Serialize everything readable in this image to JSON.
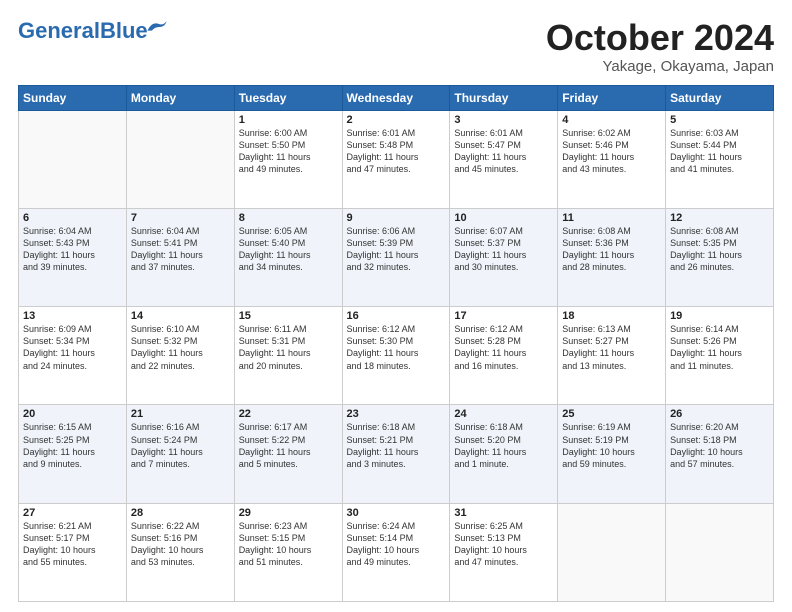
{
  "header": {
    "logo_general": "General",
    "logo_blue": "Blue",
    "title": "October 2024",
    "location": "Yakage, Okayama, Japan"
  },
  "days": [
    "Sunday",
    "Monday",
    "Tuesday",
    "Wednesday",
    "Thursday",
    "Friday",
    "Saturday"
  ],
  "weeks": [
    [
      {
        "day": "",
        "info": ""
      },
      {
        "day": "",
        "info": ""
      },
      {
        "day": "1",
        "info": "Sunrise: 6:00 AM\nSunset: 5:50 PM\nDaylight: 11 hours\nand 49 minutes."
      },
      {
        "day": "2",
        "info": "Sunrise: 6:01 AM\nSunset: 5:48 PM\nDaylight: 11 hours\nand 47 minutes."
      },
      {
        "day": "3",
        "info": "Sunrise: 6:01 AM\nSunset: 5:47 PM\nDaylight: 11 hours\nand 45 minutes."
      },
      {
        "day": "4",
        "info": "Sunrise: 6:02 AM\nSunset: 5:46 PM\nDaylight: 11 hours\nand 43 minutes."
      },
      {
        "day": "5",
        "info": "Sunrise: 6:03 AM\nSunset: 5:44 PM\nDaylight: 11 hours\nand 41 minutes."
      }
    ],
    [
      {
        "day": "6",
        "info": "Sunrise: 6:04 AM\nSunset: 5:43 PM\nDaylight: 11 hours\nand 39 minutes."
      },
      {
        "day": "7",
        "info": "Sunrise: 6:04 AM\nSunset: 5:41 PM\nDaylight: 11 hours\nand 37 minutes."
      },
      {
        "day": "8",
        "info": "Sunrise: 6:05 AM\nSunset: 5:40 PM\nDaylight: 11 hours\nand 34 minutes."
      },
      {
        "day": "9",
        "info": "Sunrise: 6:06 AM\nSunset: 5:39 PM\nDaylight: 11 hours\nand 32 minutes."
      },
      {
        "day": "10",
        "info": "Sunrise: 6:07 AM\nSunset: 5:37 PM\nDaylight: 11 hours\nand 30 minutes."
      },
      {
        "day": "11",
        "info": "Sunrise: 6:08 AM\nSunset: 5:36 PM\nDaylight: 11 hours\nand 28 minutes."
      },
      {
        "day": "12",
        "info": "Sunrise: 6:08 AM\nSunset: 5:35 PM\nDaylight: 11 hours\nand 26 minutes."
      }
    ],
    [
      {
        "day": "13",
        "info": "Sunrise: 6:09 AM\nSunset: 5:34 PM\nDaylight: 11 hours\nand 24 minutes."
      },
      {
        "day": "14",
        "info": "Sunrise: 6:10 AM\nSunset: 5:32 PM\nDaylight: 11 hours\nand 22 minutes."
      },
      {
        "day": "15",
        "info": "Sunrise: 6:11 AM\nSunset: 5:31 PM\nDaylight: 11 hours\nand 20 minutes."
      },
      {
        "day": "16",
        "info": "Sunrise: 6:12 AM\nSunset: 5:30 PM\nDaylight: 11 hours\nand 18 minutes."
      },
      {
        "day": "17",
        "info": "Sunrise: 6:12 AM\nSunset: 5:28 PM\nDaylight: 11 hours\nand 16 minutes."
      },
      {
        "day": "18",
        "info": "Sunrise: 6:13 AM\nSunset: 5:27 PM\nDaylight: 11 hours\nand 13 minutes."
      },
      {
        "day": "19",
        "info": "Sunrise: 6:14 AM\nSunset: 5:26 PM\nDaylight: 11 hours\nand 11 minutes."
      }
    ],
    [
      {
        "day": "20",
        "info": "Sunrise: 6:15 AM\nSunset: 5:25 PM\nDaylight: 11 hours\nand 9 minutes."
      },
      {
        "day": "21",
        "info": "Sunrise: 6:16 AM\nSunset: 5:24 PM\nDaylight: 11 hours\nand 7 minutes."
      },
      {
        "day": "22",
        "info": "Sunrise: 6:17 AM\nSunset: 5:22 PM\nDaylight: 11 hours\nand 5 minutes."
      },
      {
        "day": "23",
        "info": "Sunrise: 6:18 AM\nSunset: 5:21 PM\nDaylight: 11 hours\nand 3 minutes."
      },
      {
        "day": "24",
        "info": "Sunrise: 6:18 AM\nSunset: 5:20 PM\nDaylight: 11 hours\nand 1 minute."
      },
      {
        "day": "25",
        "info": "Sunrise: 6:19 AM\nSunset: 5:19 PM\nDaylight: 10 hours\nand 59 minutes."
      },
      {
        "day": "26",
        "info": "Sunrise: 6:20 AM\nSunset: 5:18 PM\nDaylight: 10 hours\nand 57 minutes."
      }
    ],
    [
      {
        "day": "27",
        "info": "Sunrise: 6:21 AM\nSunset: 5:17 PM\nDaylight: 10 hours\nand 55 minutes."
      },
      {
        "day": "28",
        "info": "Sunrise: 6:22 AM\nSunset: 5:16 PM\nDaylight: 10 hours\nand 53 minutes."
      },
      {
        "day": "29",
        "info": "Sunrise: 6:23 AM\nSunset: 5:15 PM\nDaylight: 10 hours\nand 51 minutes."
      },
      {
        "day": "30",
        "info": "Sunrise: 6:24 AM\nSunset: 5:14 PM\nDaylight: 10 hours\nand 49 minutes."
      },
      {
        "day": "31",
        "info": "Sunrise: 6:25 AM\nSunset: 5:13 PM\nDaylight: 10 hours\nand 47 minutes."
      },
      {
        "day": "",
        "info": ""
      },
      {
        "day": "",
        "info": ""
      }
    ]
  ]
}
